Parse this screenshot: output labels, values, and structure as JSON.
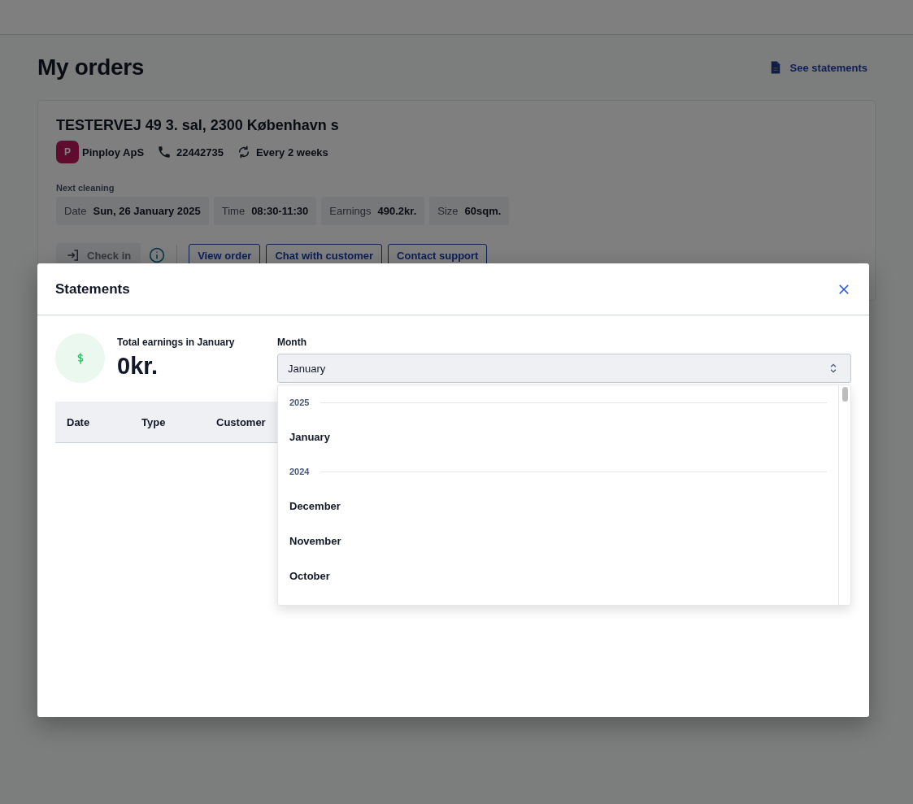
{
  "page": {
    "title": "My orders",
    "statements_link": "See statements"
  },
  "order": {
    "address": "TESTERVEJ 49 3. sal, 2300 København s",
    "customer_initial": "P",
    "customer": "Pinploy ApS",
    "phone": "22442735",
    "frequency": "Every 2 weeks",
    "next_label": "Next cleaning",
    "details": [
      {
        "label": "Date",
        "value": "Sun, 26 January 2025"
      },
      {
        "label": "Time",
        "value": "08:30-11:30"
      },
      {
        "label": "Earnings",
        "value": "490.2kr."
      },
      {
        "label": "Size",
        "value": "60sqm."
      }
    ],
    "check_in": {
      "label": "Check in",
      "disabled": true
    },
    "actions": [
      "View order",
      "Chat with customer",
      "Contact support"
    ]
  },
  "modal": {
    "title": "Statements",
    "total_label": "Total earnings in January",
    "total": "0kr.",
    "month_label": "Month",
    "month_value": "January",
    "columns": [
      "Date",
      "Type",
      "Customer"
    ],
    "dropdown": [
      {
        "kind": "group",
        "label": "2025"
      },
      {
        "kind": "option",
        "label": "January"
      },
      {
        "kind": "group",
        "label": "2024"
      },
      {
        "kind": "option",
        "label": "December"
      },
      {
        "kind": "option",
        "label": "November"
      },
      {
        "kind": "option",
        "label": "October"
      }
    ]
  }
}
